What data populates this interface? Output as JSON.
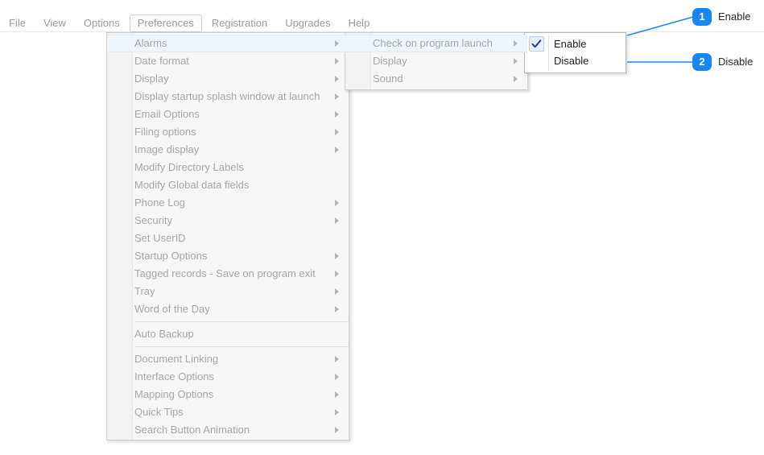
{
  "menubar": {
    "items": [
      {
        "label": "File"
      },
      {
        "label": "View"
      },
      {
        "label": "Options"
      },
      {
        "label": "Preferences",
        "active": true
      },
      {
        "label": "Registration"
      },
      {
        "label": "Upgrades"
      },
      {
        "label": "Help"
      }
    ]
  },
  "preferences_menu": {
    "items": [
      {
        "label": "Alarms",
        "submenu": true,
        "highlighted": true
      },
      {
        "label": "Date format",
        "submenu": true
      },
      {
        "label": "Display",
        "submenu": true
      },
      {
        "label": "Display startup splash window at launch",
        "submenu": true
      },
      {
        "label": "Email Options",
        "submenu": true
      },
      {
        "label": "Filing options",
        "submenu": true
      },
      {
        "label": "Image display",
        "submenu": true
      },
      {
        "label": "Modify Directory Labels",
        "submenu": false
      },
      {
        "label": "Modify Global data fields",
        "submenu": false
      },
      {
        "label": "Phone Log",
        "submenu": true
      },
      {
        "label": "Security",
        "submenu": true
      },
      {
        "label": "Set UserID",
        "submenu": false
      },
      {
        "label": "Startup Options",
        "submenu": true
      },
      {
        "label": "Tagged records - Save on program exit",
        "submenu": true
      },
      {
        "label": "Tray",
        "submenu": true
      },
      {
        "label": "Word of the Day",
        "submenu": true
      },
      {
        "separator": true
      },
      {
        "label": "Auto Backup",
        "submenu": false
      },
      {
        "separator": true
      },
      {
        "label": "Document Linking",
        "submenu": true
      },
      {
        "label": "Interface Options",
        "submenu": true
      },
      {
        "label": "Mapping Options",
        "submenu": true
      },
      {
        "label": "Quick Tips",
        "submenu": true
      },
      {
        "label": "Search Button Animation",
        "submenu": true
      }
    ]
  },
  "alarms_menu": {
    "items": [
      {
        "label": "Check on program launch",
        "submenu": true,
        "highlighted": true
      },
      {
        "label": "Display",
        "submenu": true
      },
      {
        "label": "Sound",
        "submenu": true
      }
    ]
  },
  "launch_menu": {
    "items": [
      {
        "label": "Enable",
        "checked": true
      },
      {
        "label": "Disable",
        "checked": false
      }
    ]
  },
  "callouts": [
    {
      "number": "1",
      "label": "Enable"
    },
    {
      "number": "2",
      "label": "Disable"
    }
  ],
  "colors": {
    "accent": "#1887f2",
    "menu_text": "#a6a6a6",
    "highlight_bg": "#eef5fb",
    "check_blue": "#24349e"
  }
}
